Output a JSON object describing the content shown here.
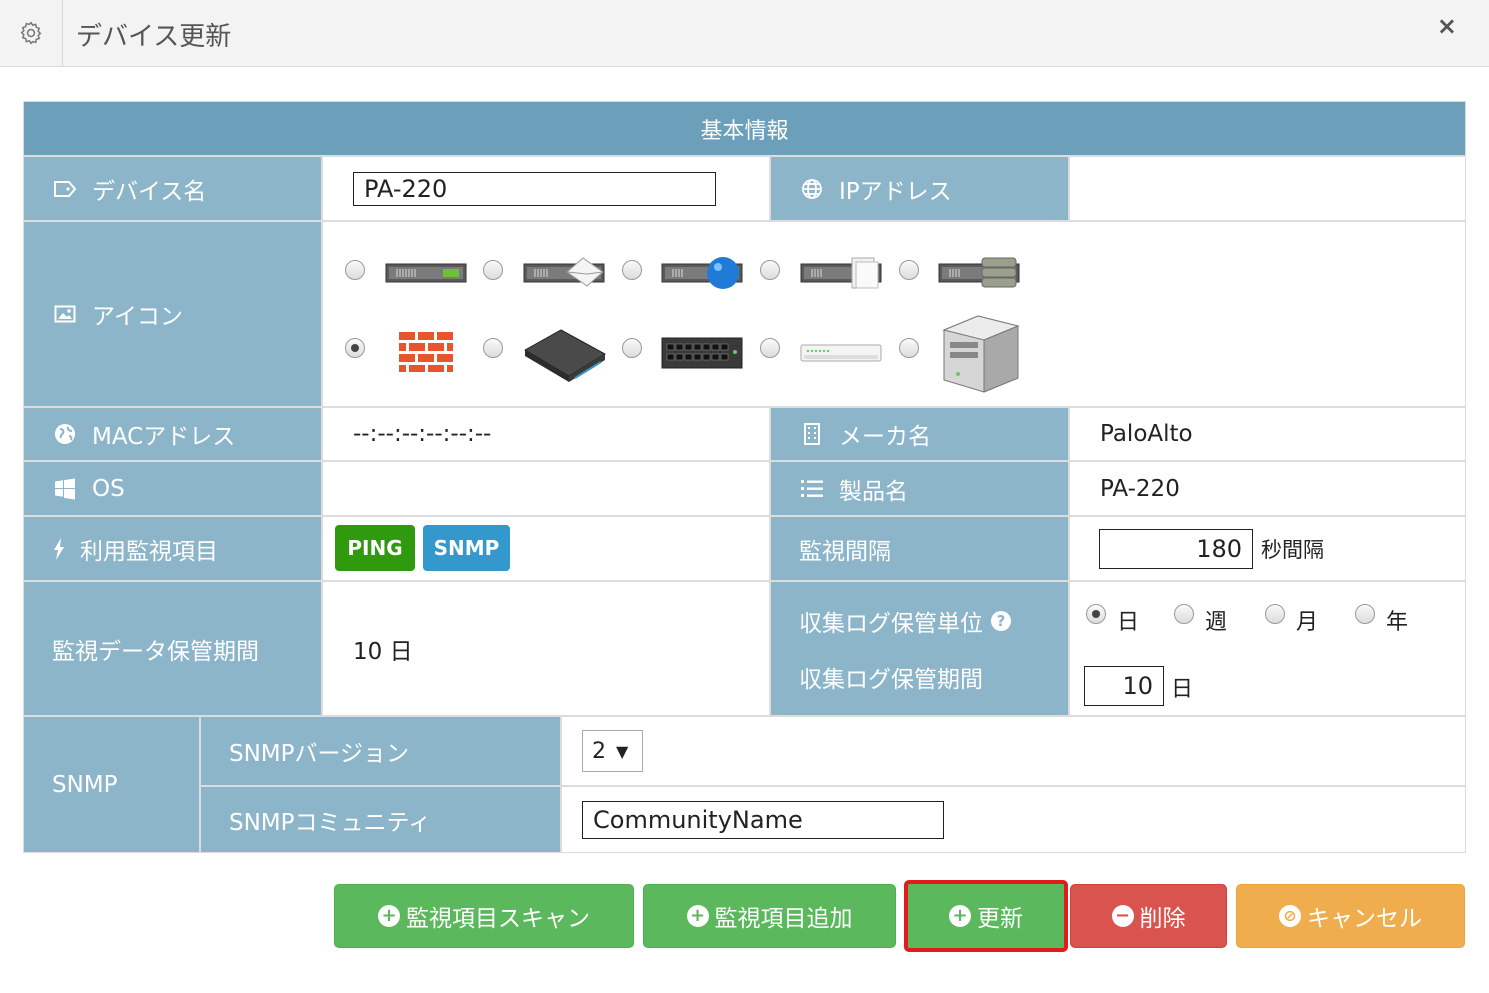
{
  "dialog": {
    "title": "デバイス更新",
    "close_glyph": "×"
  },
  "section_header": "基本情報",
  "fields": {
    "device_name": {
      "label": "デバイス名",
      "value": "PA-220"
    },
    "ip_address": {
      "label": "IPアドレス",
      "value": ""
    },
    "icon": {
      "label": "アイコン",
      "selected_index": 5
    },
    "mac_address": {
      "label": "MACアドレス",
      "value": "--:--:--:--:--:--"
    },
    "maker": {
      "label": "メーカ名",
      "value": "PaloAlto"
    },
    "os": {
      "label": "OS",
      "value": ""
    },
    "product": {
      "label": "製品名",
      "value": "PA-220"
    },
    "monitor_items": {
      "label": "利用監視項目",
      "badges": [
        "PING",
        "SNMP"
      ]
    },
    "interval": {
      "label": "監視間隔",
      "value": "180",
      "unit": "秒間隔"
    },
    "retention": {
      "label": "監視データ保管期間",
      "value": "10 日"
    },
    "log_unit": {
      "label": "収集ログ保管単位",
      "options": [
        "日",
        "週",
        "月",
        "年"
      ],
      "selected": "日"
    },
    "log_period": {
      "label": "収集ログ保管期間",
      "value": "10",
      "unit": "日"
    },
    "snmp": {
      "label": "SNMP",
      "version_label": "SNMPバージョン",
      "version_value": "2",
      "community_label": "SNMPコミュニティ",
      "community_value": "CommunityName"
    }
  },
  "buttons": {
    "scan": "監視項目スキャン",
    "add": "監視項目追加",
    "update": "更新",
    "delete": "削除",
    "cancel": "キャンセル"
  },
  "colors": {
    "header": "#6b9fba",
    "label": "#8cb5ca",
    "ping_badge": "#2f9a0e",
    "snmp_badge": "#3399cc",
    "btn_green": "#5cb85c",
    "btn_red": "#d9534f",
    "btn_orange": "#f0ad4e",
    "highlight_border": "#e21b1b"
  }
}
